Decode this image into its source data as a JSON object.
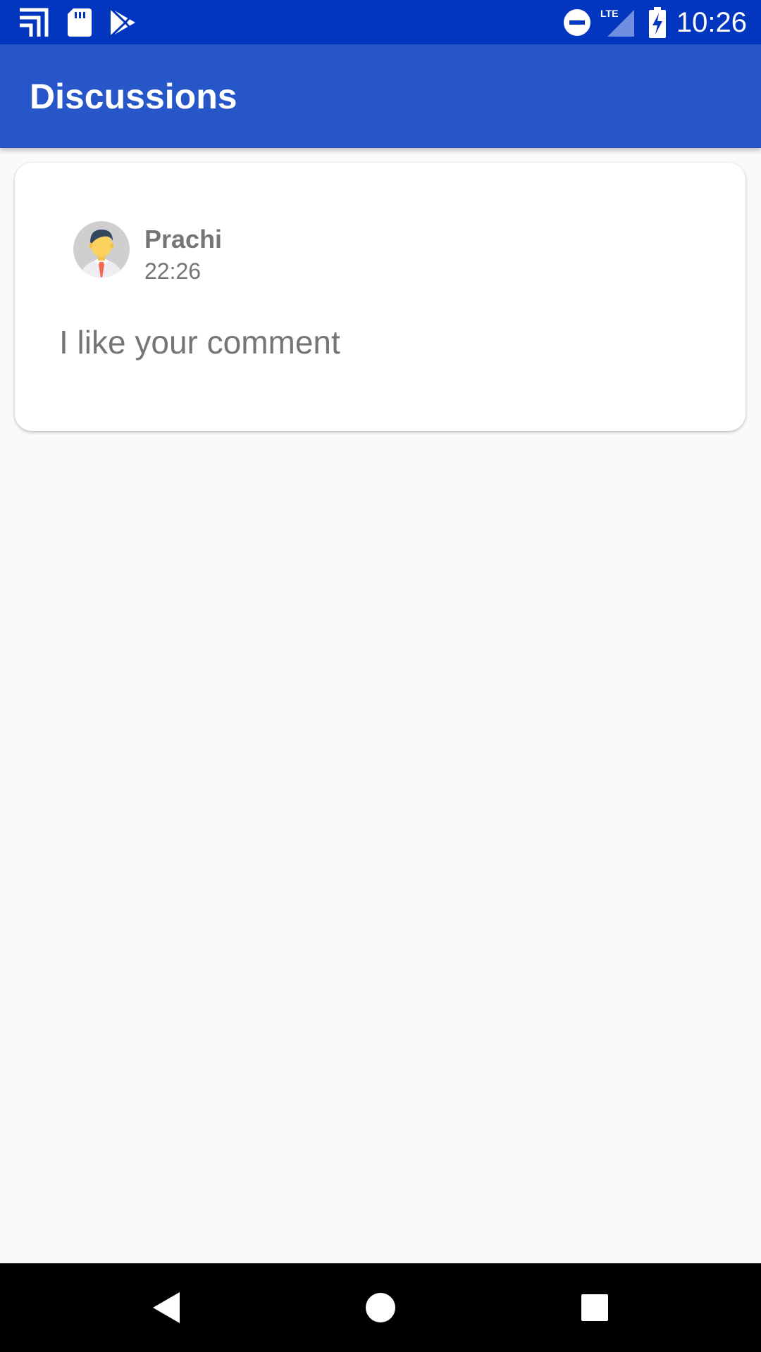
{
  "status_bar": {
    "time": "10:26",
    "left_icons": [
      "cast-icon",
      "sd-card-icon",
      "play-store-icon"
    ],
    "right_icons": [
      "do-not-disturb-icon",
      "lte-signal-icon",
      "battery-charging-icon"
    ],
    "lte_label": "LTE",
    "background": "#0336be"
  },
  "app_bar": {
    "title": "Discussions",
    "background": "#2656c7"
  },
  "discussions": [
    {
      "author": "Prachi",
      "time": "22:26",
      "message": "I like your comment",
      "avatar_icon": "user-avatar-icon"
    }
  ],
  "nav_bar": {
    "buttons": [
      "back-icon",
      "home-icon",
      "recents-icon"
    ]
  }
}
